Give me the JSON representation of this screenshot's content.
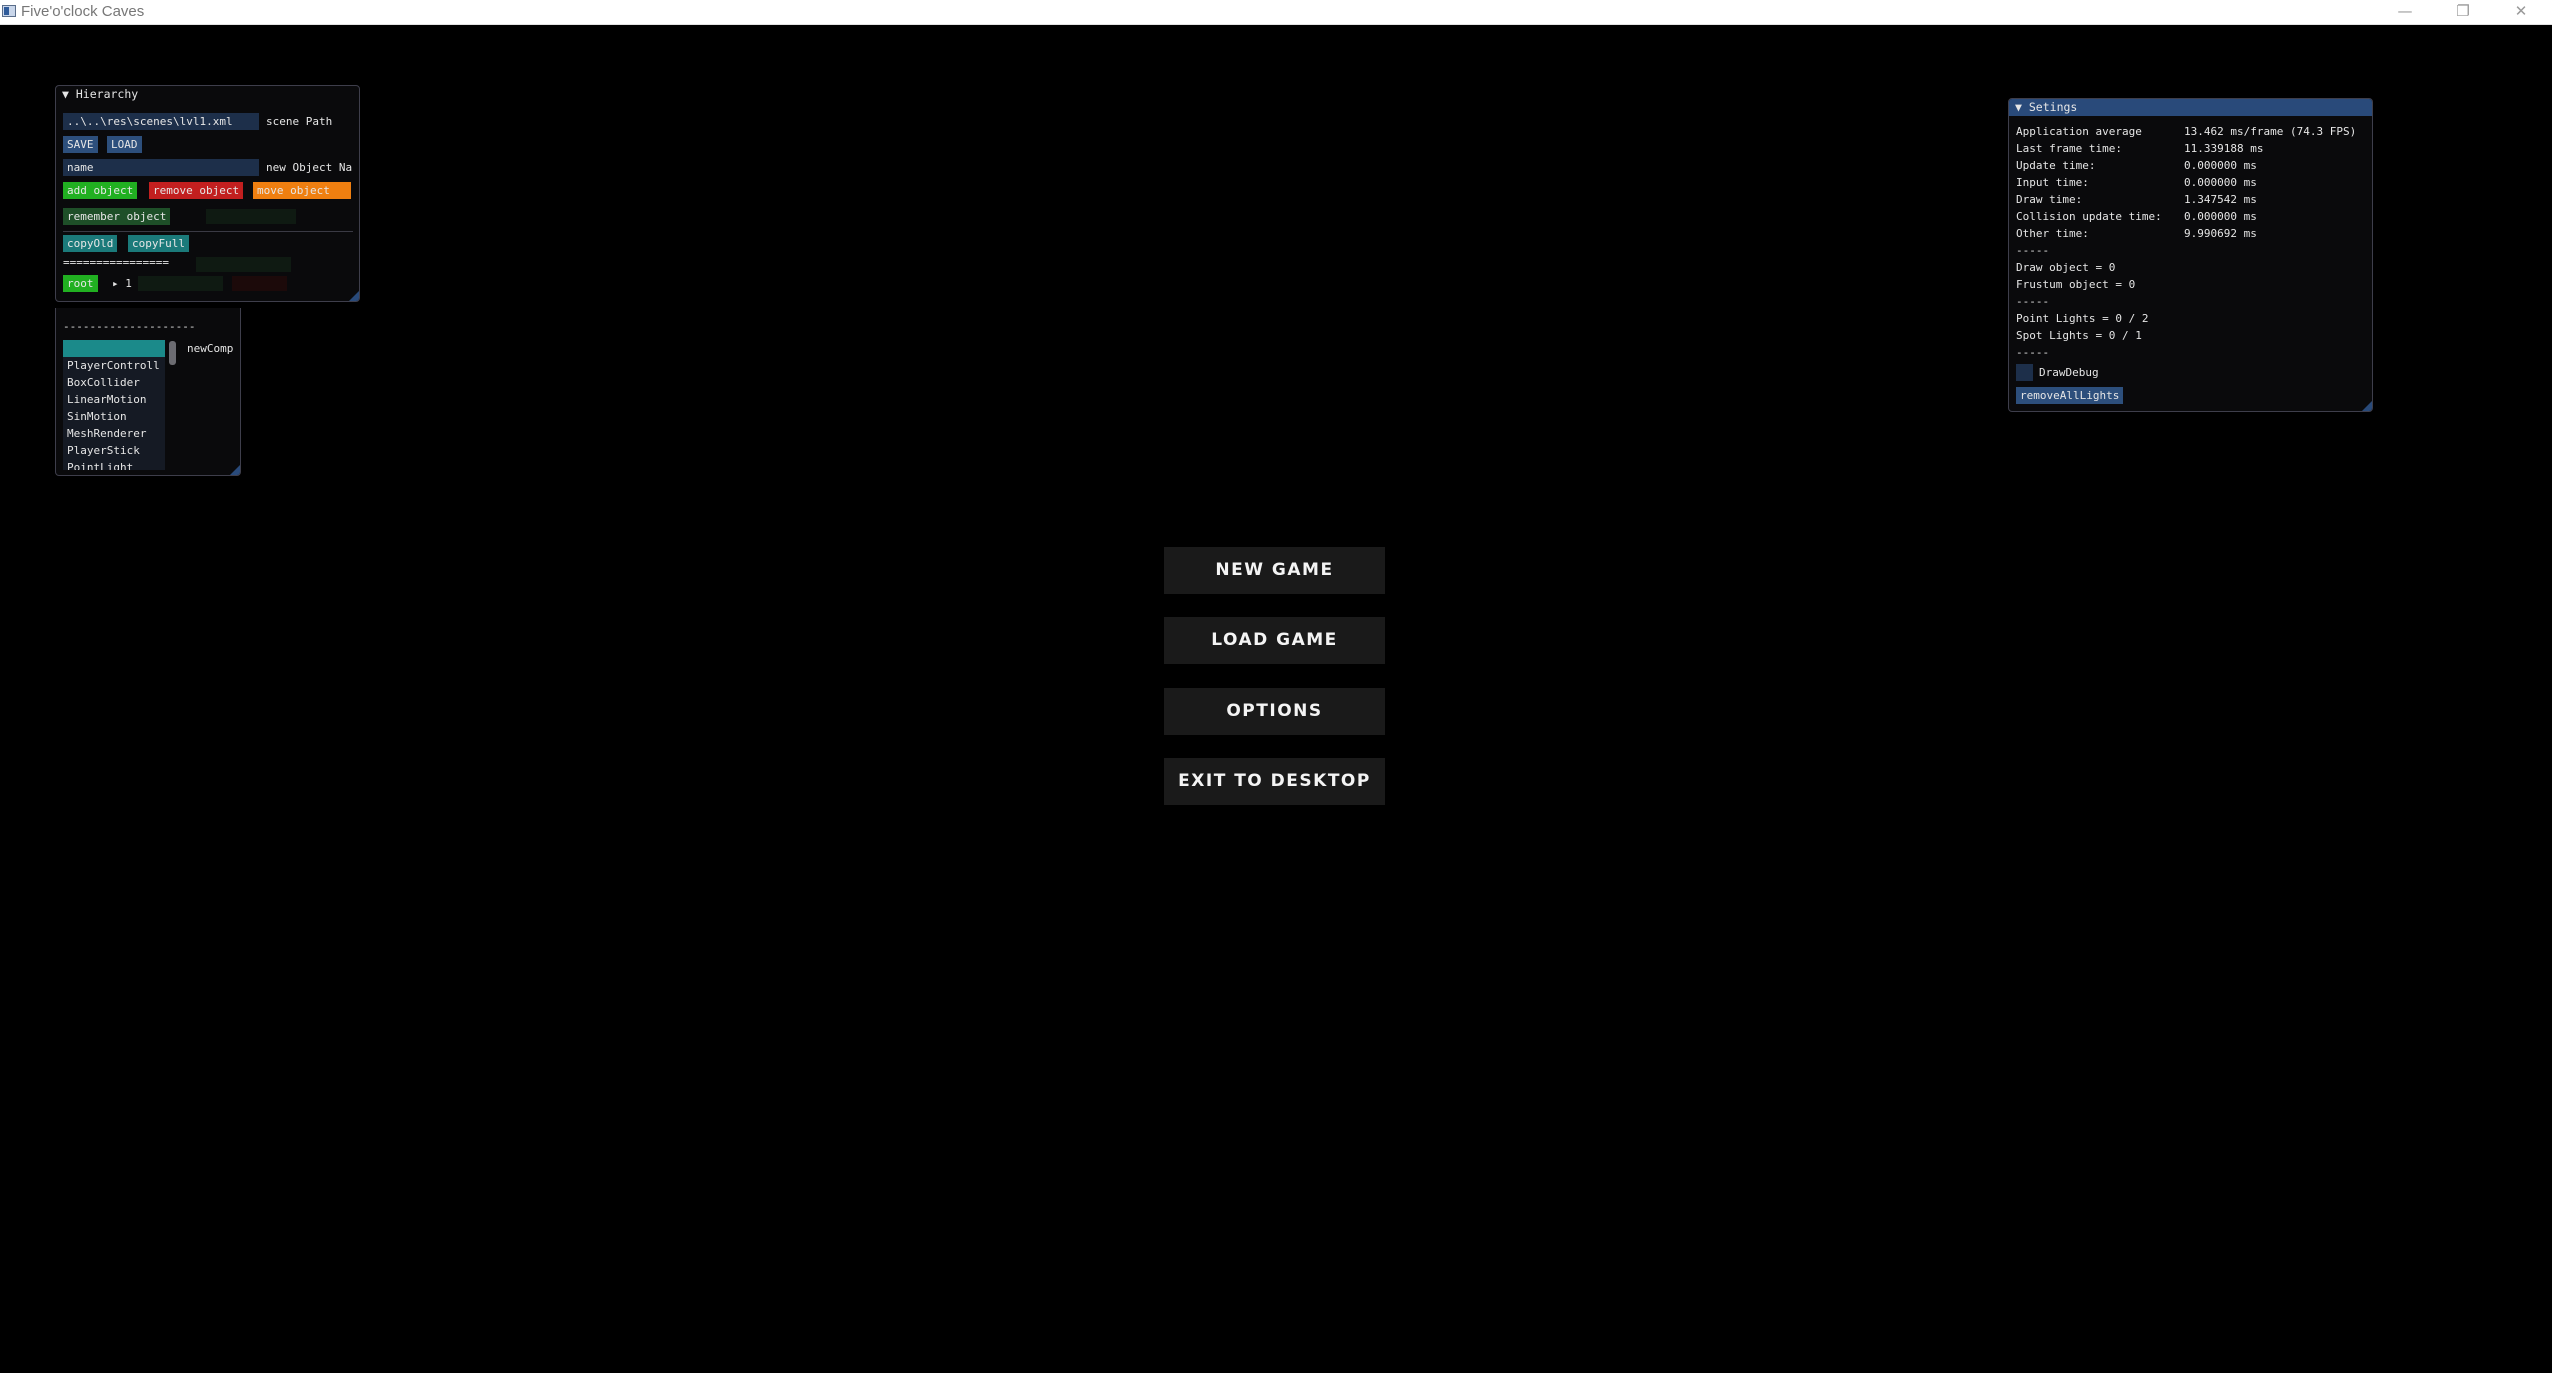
{
  "window": {
    "title": "Five'o'clock Caves",
    "controls": {
      "minimize": "—",
      "restore": "❐",
      "close": "✕"
    }
  },
  "hierarchy": {
    "title": "Hierarchy",
    "scene_path_value": "..\\..\\res\\scenes\\lvl1.xml",
    "scene_path_label": "scene Path",
    "save_label": "SAVE",
    "load_label": "LOAD",
    "name_value": "name",
    "name_label": "new Object Na",
    "add_label": "add object",
    "remove_label": "remove object",
    "move_label": "move object",
    "remember_label": "remember object",
    "copy_old_label": "copyOld",
    "copy_full_label": "copyFull",
    "separator_1": "================",
    "root_label": "root",
    "child_label": "▸ 1"
  },
  "components": {
    "separator": "--------------------",
    "new_comp_label": "newComp",
    "items": [
      "",
      "PlayerControll",
      "BoxCollider",
      "LinearMotion",
      "SinMotion",
      "MeshRenderer",
      "PlayerStick",
      "PointLight"
    ]
  },
  "settings": {
    "title": "Setings",
    "rows": [
      {
        "label": "Application average",
        "value": "13.462 ms/frame (74.3 FPS)"
      },
      {
        "label": "Last frame time:",
        "value": "11.339188 ms"
      },
      {
        "label": "Update time:",
        "value": "0.000000 ms"
      },
      {
        "label": "Input time:",
        "value": "0.000000 ms"
      },
      {
        "label": "Draw time:",
        "value": "1.347542 ms"
      },
      {
        "label": "Collision update time:",
        "value": "0.000000 ms"
      },
      {
        "label": "Other time:",
        "value": "9.990692 ms"
      }
    ],
    "divider": "-----",
    "draw_object": "Draw object    = 0",
    "frustum_object": "Frustum object = 0",
    "point_lights": "Point Lights = 0 / 2",
    "spot_lights": "Spot  Lights = 0 / 1",
    "draw_debug_label": "DrawDebug",
    "draw_debug_checked": false,
    "remove_lights_label": "removeAllLights"
  },
  "main_menu": {
    "new_game": "NEW GAME",
    "load_game": "LOAD GAME",
    "options": "OPTIONS",
    "exit": "EXIT TO DESKTOP"
  },
  "colors": {
    "imgui_header": "#294a7a",
    "add_green": "#21b021",
    "remove_red": "#c21f1f",
    "move_orange": "#ef7f10",
    "teal": "#1b7a7a",
    "menu_button_bg": "#1a1a1a"
  }
}
